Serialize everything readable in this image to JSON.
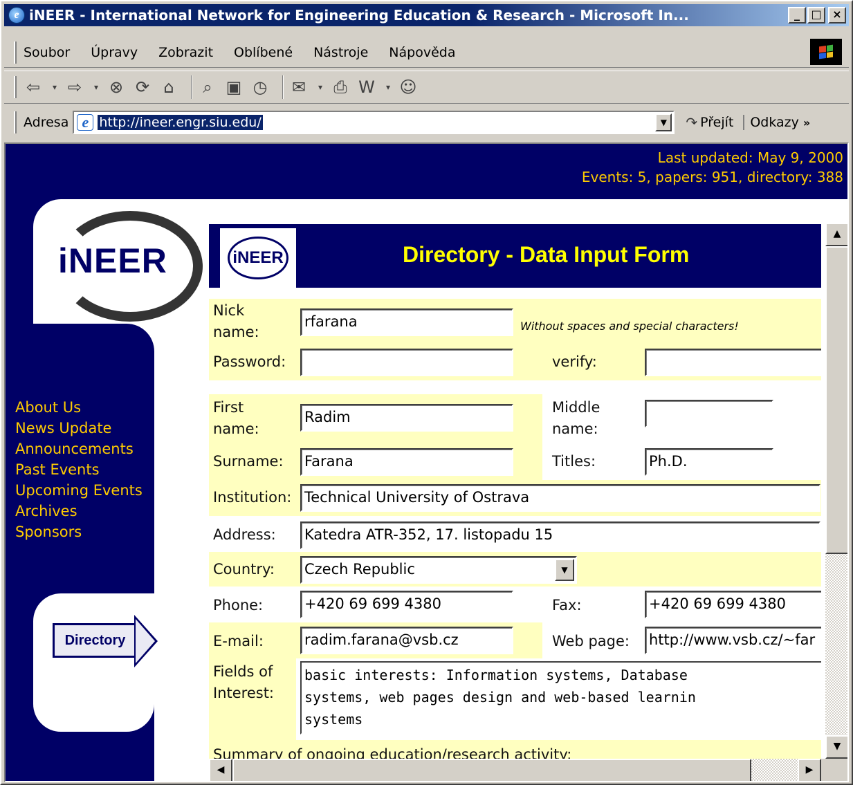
{
  "window": {
    "title": "iNEER - International Network for Engineering Education & Research - Microsoft In...",
    "minimize_glyph": "_",
    "maximize_glyph": "□",
    "close_glyph": "×"
  },
  "menu": {
    "items": [
      "Soubor",
      "Úpravy",
      "Zobrazit",
      "Oblíbené",
      "Nástroje",
      "Nápověda"
    ]
  },
  "toolbar": {
    "icons": [
      "back-icon",
      "forward-icon",
      "stop-icon",
      "refresh-icon",
      "home-icon",
      "search-icon",
      "favorites-icon",
      "history-icon",
      "mail-icon",
      "print-icon",
      "edit-icon",
      "messenger-icon"
    ]
  },
  "address": {
    "label": "Adresa",
    "url": "http://ineer.engr.siu.edu/",
    "go_label": "Přejít",
    "links_label": "Odkazy",
    "links_chevron": "»"
  },
  "site": {
    "last_updated": "Last updated: May 9, 2000",
    "counts": "Events: 5, papers: 951, directory: 388",
    "logo_text": "iNEER",
    "nav": [
      "About Us",
      "News Update",
      "Announcements",
      "Past Events",
      "Upcoming Events",
      "Archives",
      "Sponsors"
    ],
    "directory_badge": "Directory"
  },
  "form": {
    "header_logo": "iNEER",
    "title": "Directory - Data Input Form",
    "nick_label_1": "Nick",
    "nick_label_2": "name:",
    "nick_value": "rfarana",
    "nick_hint": "Without spaces and special characters!",
    "password_label": "Password:",
    "verify_label": "verify:",
    "first_label_1": "First",
    "first_label_2": "name:",
    "first_value": "Radim",
    "middle_label_1": "Middle",
    "middle_label_2": "name:",
    "surname_label": "Surname:",
    "surname_value": "Farana",
    "titles_label": "Titles:",
    "titles_value": "Ph.D.",
    "institution_label": "Institution:",
    "institution_value": "Technical University of Ostrava",
    "address_label": "Address:",
    "address_value": "Katedra ATR-352, 17. listopadu 15",
    "country_label": "Country:",
    "country_value": "Czech Republic",
    "phone_label": "Phone:",
    "phone_value": "+420 69 699 4380",
    "fax_label": "Fax:",
    "fax_value": "+420 69 699 4380",
    "email_label": "E-mail:",
    "email_value": "radim.farana@vsb.cz",
    "web_label": "Web page:",
    "web_value": "http://www.vsb.cz/~far",
    "fields_label_1": "Fields of",
    "fields_label_2": "Interest:",
    "fields_value": "basic interests: Information systems, Database\nsystems, web pages design and web-based learnin\nsystems",
    "summary_label": "Summary of ongoing education/research activity:"
  },
  "colors": {
    "page_bg": "#000066",
    "accent_yellow": "#ffcc00",
    "form_row_yellow": "#ffffc0",
    "title_yellow": "#ffff00"
  }
}
